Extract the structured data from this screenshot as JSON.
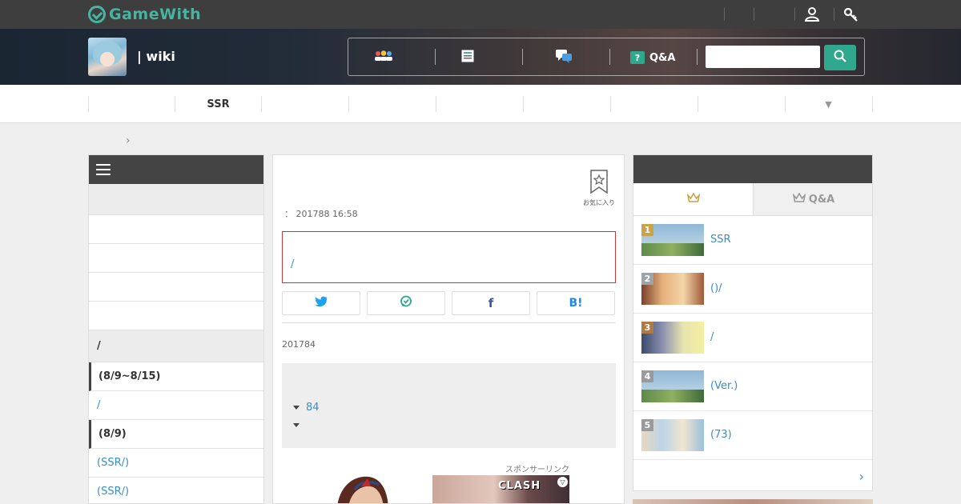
{
  "brand": {
    "logo_text": "GameWith",
    "accent": "#46b4a0"
  },
  "header": {
    "site_title": "| wiki",
    "nav": [
      {
        "icon": "group-icon",
        "label": ""
      },
      {
        "icon": "list-icon",
        "label": ""
      },
      {
        "icon": "chat-icon",
        "label": ""
      },
      {
        "icon": "qa-icon",
        "label": "Q&A"
      }
    ],
    "search": {
      "placeholder": ""
    },
    "top_icons": [
      "user-icon",
      "key-icon"
    ]
  },
  "tabs": [
    "",
    "SSR",
    "",
    "",
    "",
    "",
    "",
    "",
    "▼"
  ],
  "sidebar": {
    "items": [
      {
        "text": "",
        "style": "gray"
      },
      {
        "text": "",
        "style": "plain"
      },
      {
        "text": "",
        "style": "plain"
      },
      {
        "text": "",
        "style": "plain"
      },
      {
        "text": "",
        "style": "plain"
      },
      {
        "text": "/",
        "style": "section"
      },
      {
        "text": "(8/9~8/15)",
        "style": "bold"
      },
      {
        "text": "/",
        "style": "link"
      },
      {
        "text": "(8/9)",
        "style": "bold"
      },
      {
        "text": "(SSR/)",
        "style": "link"
      },
      {
        "text": "(SSR/)",
        "style": "link"
      }
    ]
  },
  "article": {
    "favorite_label": "お気に入り",
    "updated": "：  201788 16:58",
    "notice_text": "/",
    "share": [
      "twitter",
      "line",
      "facebook",
      "hatena"
    ],
    "share_labels": {
      "hatena": "B!",
      "facebook": "f"
    },
    "published": "201784",
    "toc": [
      {
        "text": "84"
      },
      {
        "text": ""
      }
    ],
    "sponsor_label": "スポンサーリンク",
    "ad_text": "CLASH"
  },
  "ranking": {
    "tabs": [
      {
        "icon": "crown-icon",
        "label": "",
        "active": true
      },
      {
        "icon": "crown-icon",
        "label": "Q&A",
        "active": false
      }
    ],
    "items": [
      {
        "rank": "1",
        "label": "SSR",
        "badge_color": "#c9a24a"
      },
      {
        "rank": "2",
        "label": "()/",
        "badge_color": "#9aa4ad"
      },
      {
        "rank": "3",
        "label": "/",
        "badge_color": "#b07a45"
      },
      {
        "rank": "4",
        "label": "(Ver.)",
        "badge_color": "#9a9a9a"
      },
      {
        "rank": "5",
        "label": "(73)",
        "badge_color": "#9a9a9a"
      }
    ],
    "more": "›"
  }
}
